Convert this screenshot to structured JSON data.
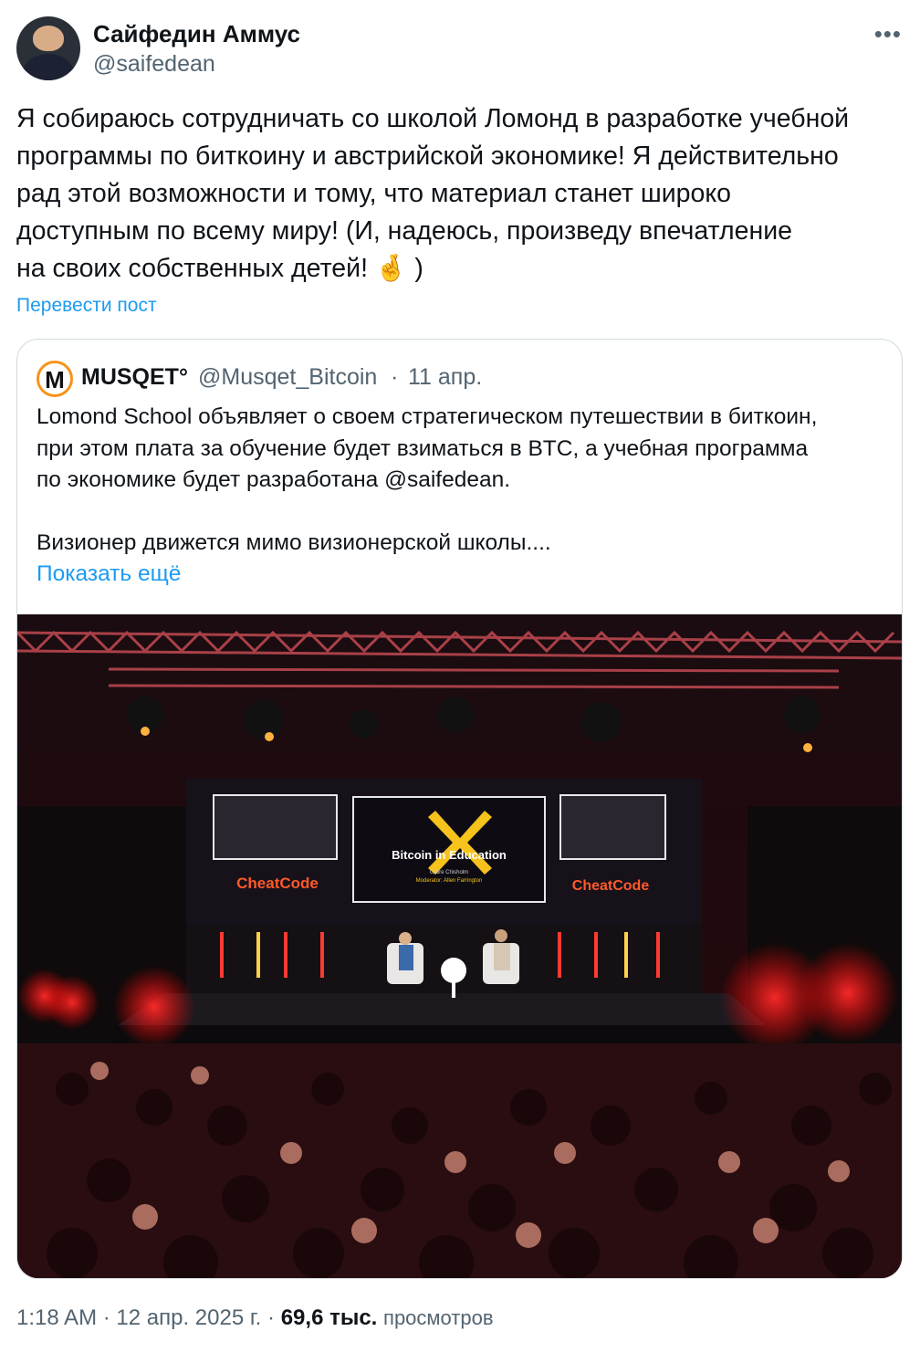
{
  "author": {
    "name": "Сайфедин Аммус",
    "handle": "@saifedean"
  },
  "tweet": {
    "text": "Я собираюсь сотрудничать со школой Ломонд в разработке учебной\nпрограммы по биткоину и австрийской экономике! Я действительно\nрад этой возможности и тому, что материал станет широко\nдоступным по всему миру! (И, надеюсь, произведу впечатление\nна своих собственных детей! 🤞 )",
    "translate_label": "Перевести пост"
  },
  "quote": {
    "name": "MUSQET°",
    "handle": "@Musqet_Bitcoin",
    "separator": "·",
    "date": "11 апр.",
    "avatar_letter": "M",
    "text": "Lomond School объявляет о своем стратегическом путешествии в биткоин,\nпри этом плата за обучение будет взиматься в BTC, а учебная программа\nпо экономике будет разработана @saifedean.\n\nВизионер движется мимо визионерской школы....",
    "show_more_label": "Показать ещё",
    "photo": {
      "screen_title": "Bitcoin in Education",
      "screen_names": "Claire Chisholm",
      "screen_moderator": "Moderator: Allen Farrington",
      "side_logo": "CheatCode",
      "center_logo": "CheatCode"
    }
  },
  "footer": {
    "time": "1:18 AM",
    "sep1": "·",
    "date": "12 апр. 2025 г.",
    "sep2": "·",
    "views_count": "69,6 тыс.",
    "views_label": "просмотров"
  },
  "colors": {
    "text": "#0f1419",
    "secondary": "#536471",
    "link": "#1d9bf0",
    "border": "#cfd9de",
    "musqet_orange": "#f7931a",
    "stage_red": "#e4262b"
  },
  "icons": [
    "more-icon",
    "crossed-fingers-emoji"
  ]
}
